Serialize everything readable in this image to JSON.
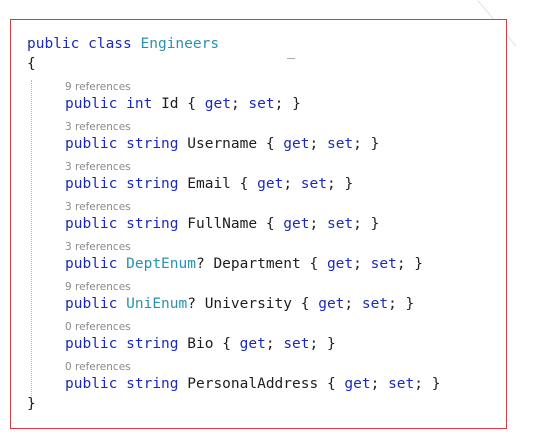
{
  "code": {
    "class_decl": {
      "keywords": "public class",
      "name": "Engineers"
    },
    "open_brace": "{",
    "close_brace": "}",
    "properties": [
      {
        "refs": "9 references",
        "modifier": "public",
        "type": "int",
        "type_is_keyword": true,
        "name": "Id",
        "nullable": "",
        "accessors": "{ get; set; }"
      },
      {
        "refs": "3 references",
        "modifier": "public",
        "type": "string",
        "type_is_keyword": true,
        "name": "Username",
        "nullable": "",
        "accessors": "{ get; set; }"
      },
      {
        "refs": "3 references",
        "modifier": "public",
        "type": "string",
        "type_is_keyword": true,
        "name": "Email",
        "nullable": "",
        "accessors": "{ get; set; }"
      },
      {
        "refs": "3 references",
        "modifier": "public",
        "type": "string",
        "type_is_keyword": true,
        "name": "FullName",
        "nullable": "",
        "accessors": "{ get; set; }"
      },
      {
        "refs": "3 references",
        "modifier": "public",
        "type": "DeptEnum",
        "type_is_keyword": false,
        "name": "Department",
        "nullable": "?",
        "accessors": "{ get; set; }"
      },
      {
        "refs": "9 references",
        "modifier": "public",
        "type": "UniEnum",
        "type_is_keyword": false,
        "name": "University",
        "nullable": "?",
        "accessors": "{ get; set; }"
      },
      {
        "refs": "0 references",
        "modifier": "public",
        "type": "string",
        "type_is_keyword": true,
        "name": "Bio",
        "nullable": "",
        "accessors": "{ get; set; }"
      },
      {
        "refs": "0 references",
        "modifier": "public",
        "type": "string",
        "type_is_keyword": true,
        "name": "PersonalAddress",
        "nullable": "",
        "accessors": "{ get; set; }"
      }
    ]
  },
  "colors": {
    "keyword": "#1b2bb3",
    "type": "#2b91af",
    "text": "#1e1e1e",
    "codelens": "#8a8a8a",
    "frame_border": "#c9424b"
  }
}
